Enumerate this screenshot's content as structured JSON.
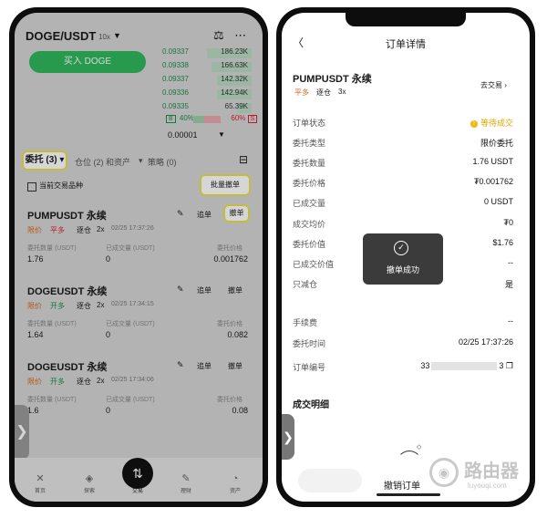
{
  "left": {
    "pair": "DOGE/USDT",
    "leverage": "10x",
    "top_icons": "⚖ ⋯",
    "buy_button": "买入 DOGE",
    "order_book": [
      {
        "price": "0.09337",
        "qty": "186.23K",
        "fill": 0.45
      },
      {
        "price": "0.09338",
        "qty": "166.63K",
        "fill": 0.4
      },
      {
        "price": "0.09337",
        "qty": "142.32K",
        "fill": 0.35
      },
      {
        "price": "0.09336",
        "qty": "142.94K",
        "fill": 0.35
      },
      {
        "price": "0.09335",
        "qty": "65.39K",
        "fill": 0.15
      }
    ],
    "ratio": {
      "buy_tag": "B",
      "buy_pct": "40%",
      "buy_fraction": 0.4,
      "sell_pct": "60%",
      "sell_tag": "S"
    },
    "price_select": "0.00001",
    "tabs": {
      "orders": "委托 (3)",
      "positions": "仓位 (2) 和资产",
      "strategies": "策略 (0)"
    },
    "checkbox_label": "当前交易品种",
    "batch_cancel": "批量撤单",
    "orders": [
      {
        "symbol": "PUMPUSDT 永续",
        "type": "限价",
        "side": "平多",
        "mode": "逐仓",
        "lev": "2x",
        "time": "02/25 17:37:26",
        "lbl_qty": "委托数量 (USDT)",
        "lbl_filled": "已成交量 (USDT)",
        "lbl_price": "委托价格",
        "qty": "1.76",
        "filled": "0",
        "price": "0.001762",
        "chase": "追单",
        "cancel": "撤单"
      },
      {
        "symbol": "DOGEUSDT 永续",
        "type": "限价",
        "side": "开多",
        "mode": "逐仓",
        "lev": "2x",
        "time": "02/25 17:34:15",
        "lbl_qty": "委托数量 (USDT)",
        "lbl_filled": "已成交量 (USDT)",
        "lbl_price": "委托价格",
        "qty": "1.64",
        "filled": "0",
        "price": "0.082",
        "chase": "追单",
        "cancel": "撤单"
      },
      {
        "symbol": "DOGEUSDT 永续",
        "type": "限价",
        "side": "开多",
        "mode": "逐仓",
        "lev": "2x",
        "time": "02/25 17:34:06",
        "lbl_qty": "委托数量 (USDT)",
        "lbl_filled": "已成交量 (USDT)",
        "lbl_price": "委托价格",
        "qty": "1.6",
        "filled": "0",
        "price": "0.08",
        "chase": "追单",
        "cancel": "撤单"
      }
    ],
    "tabbar": {
      "home": "首页",
      "explore": "探索",
      "trade": "交易",
      "earn": "理财",
      "assets": "资产"
    }
  },
  "right": {
    "title": "订单详情",
    "symbol": "PUMPUSDT 永续",
    "tag_side": "平多",
    "tag_mode": "逐仓",
    "tag_lev": "3x",
    "go_trade": "去交易",
    "rows": [
      {
        "k": "订单状态",
        "v": "等待成交"
      },
      {
        "k": "委托类型",
        "v": "限价委托"
      },
      {
        "k": "委托数量",
        "v": "1.76 USDT"
      },
      {
        "k": "委托价格",
        "v": "₮0.001762"
      },
      {
        "k": "已成交量",
        "v": "0 USDT"
      },
      {
        "k": "成交均价",
        "v": "₮0"
      },
      {
        "k": "委托价值",
        "v": "$1.76"
      },
      {
        "k": "已成交价值",
        "v": "--"
      },
      {
        "k": "只减仓",
        "v": "是"
      },
      {
        "k": "手续费",
        "v": "--"
      },
      {
        "k": "委托时间",
        "v": "02/25 17:37:26"
      }
    ],
    "order_no_label": "订单编号",
    "order_no_prefix": "33",
    "order_no_suffix": "3",
    "toast": "撤单成功",
    "section": "成交明细",
    "cancel_order": "撤销订单",
    "watermark_title": "路由器",
    "watermark_url": "luyouqi.com"
  }
}
